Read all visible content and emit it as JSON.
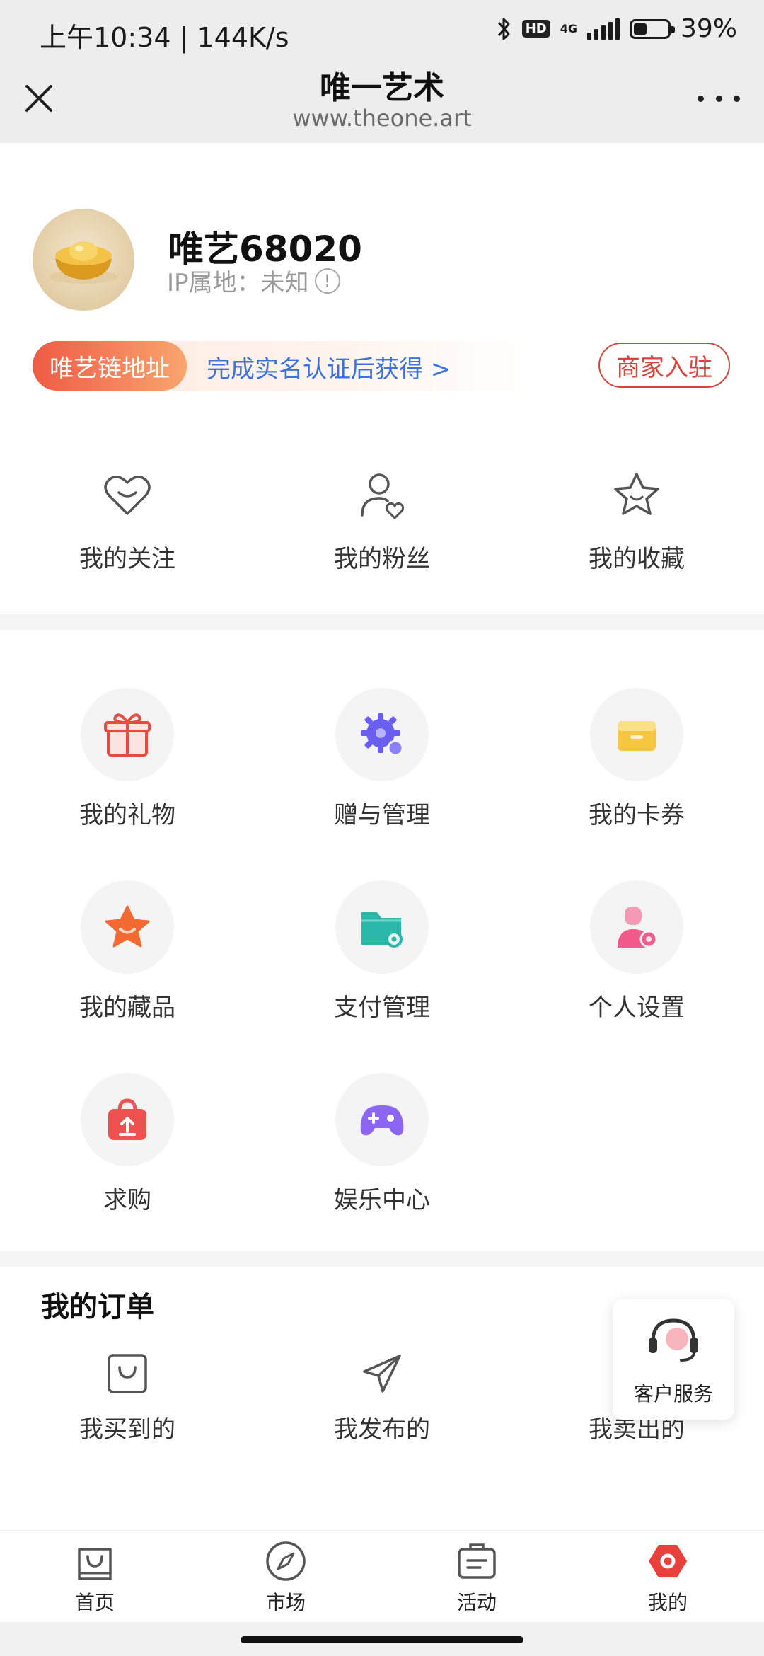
{
  "status_bar": {
    "time_speed": "上午10:34 | 144K/s",
    "hd": "HD",
    "network": "4G",
    "battery": "39%",
    "battery_level": 0.39
  },
  "header": {
    "title": "唯一艺术",
    "subtitle": "www.theone.art"
  },
  "profile": {
    "username": "唯艺68020",
    "ip_label": "IP属地：未知",
    "info_glyph": "!",
    "chain_badge": "唯艺链地址",
    "chain_link": "完成实名认证后获得 >",
    "merchant_button": "商家入驻"
  },
  "social": [
    {
      "label": "我的关注",
      "icon": "heart-smile-icon"
    },
    {
      "label": "我的粉丝",
      "icon": "user-heart-icon"
    },
    {
      "label": "我的收藏",
      "icon": "star-smile-icon"
    }
  ],
  "services": [
    {
      "label": "我的礼物",
      "icon": "gift-icon",
      "color": "#e84a3f"
    },
    {
      "label": "赠与管理",
      "icon": "gear-icon",
      "color": "#6a5ef0"
    },
    {
      "label": "我的卡券",
      "icon": "wallet-icon",
      "color": "#f7c640"
    },
    {
      "label": "我的藏品",
      "icon": "star-icon",
      "color": "#f26a32"
    },
    {
      "label": "支付管理",
      "icon": "folder-gear-icon",
      "color": "#2bb8a8"
    },
    {
      "label": "个人设置",
      "icon": "user-settings-icon",
      "color": "#f25a8a"
    },
    {
      "label": "求购",
      "icon": "bag-upload-icon",
      "color": "#ef5050"
    },
    {
      "label": "娱乐中心",
      "icon": "gamepad-icon",
      "color": "#8c66f2"
    }
  ],
  "orders": {
    "title": "我的订单",
    "items": [
      {
        "label": "我买到的",
        "icon": "bag-icon"
      },
      {
        "label": "我发布的",
        "icon": "send-icon"
      },
      {
        "label": "我卖出的",
        "icon": "sold-icon"
      }
    ]
  },
  "customer_service": {
    "label": "客户服务",
    "icon": "headset-icon"
  },
  "tabbar": [
    {
      "label": "首页",
      "icon": "shopping-bag-icon"
    },
    {
      "label": "市场",
      "icon": "compass-icon"
    },
    {
      "label": "活动",
      "icon": "ticket-icon"
    },
    {
      "label": "我的",
      "icon": "profile-hex-icon",
      "active_color": "#e8403a"
    }
  ]
}
